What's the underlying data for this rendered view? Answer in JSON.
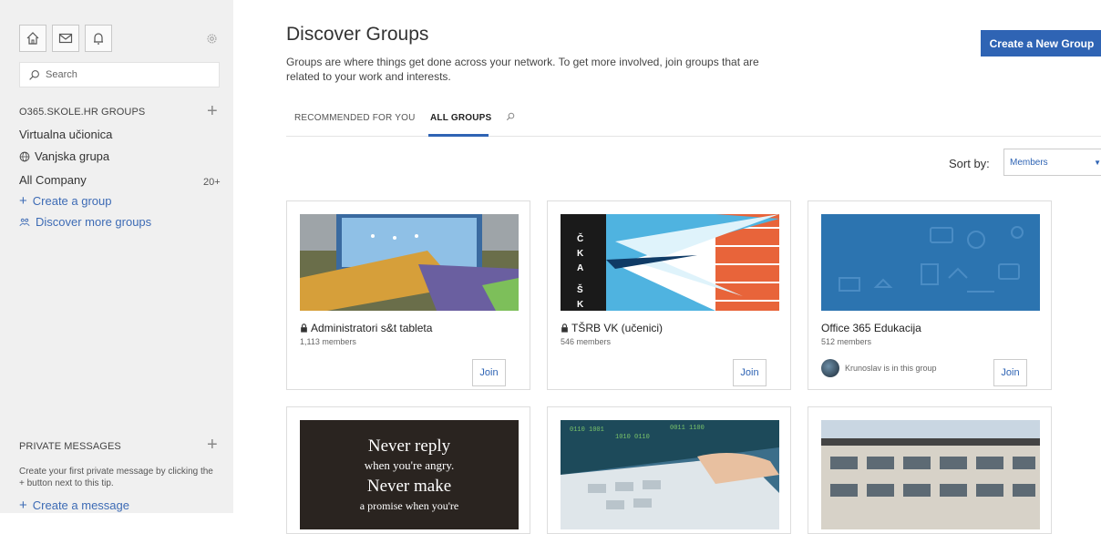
{
  "sidebar": {
    "search_placeholder": "Search",
    "groups_heading": "O365.SKOLE.HR GROUPS",
    "groups": [
      {
        "label": "Virtualna učionica"
      },
      {
        "label": "Vanjska grupa"
      },
      {
        "label": "All Company",
        "count": "20+"
      }
    ],
    "create_group": "Create a group",
    "discover_more": "Discover more groups",
    "pm_heading": "PRIVATE MESSAGES",
    "pm_tip": "Create your first private message by clicking the + button next to this tip.",
    "create_message": "Create a message"
  },
  "header": {
    "title": "Discover Groups",
    "subtitle": "Groups are where things get done across your network. To get more involved, join groups that are related to your work and interests.",
    "create_button": "Create a New Group"
  },
  "tabs": [
    {
      "label": "RECOMMENDED FOR YOU",
      "active": false
    },
    {
      "label": "ALL GROUPS",
      "active": true
    }
  ],
  "sort": {
    "label": "Sort by:",
    "value": "Members"
  },
  "cards": [
    {
      "title": "Administratori s&t tableta",
      "members": "1,113 members",
      "private": true,
      "join": "Join"
    },
    {
      "title": "TŠRB VK (učenici)",
      "members": "546 members",
      "private": true,
      "join": "Join"
    },
    {
      "title": "Office 365 Edukacija",
      "members": "512 members",
      "private": false,
      "in_group": "Krunoslav is in this group",
      "join": "Join"
    }
  ],
  "quote_image": {
    "line1": "Never reply",
    "line2": "when you're angry.",
    "line3": "Never make",
    "line4": "a promise when you're"
  },
  "colors": {
    "accent": "#2f64b4",
    "sidebar_bg": "#f0f0f0"
  },
  "icons": [
    "home-icon",
    "mail-icon",
    "bell-icon",
    "gear-icon",
    "search-icon",
    "plus-icon",
    "globe-icon",
    "lock-icon",
    "groups-icon"
  ]
}
